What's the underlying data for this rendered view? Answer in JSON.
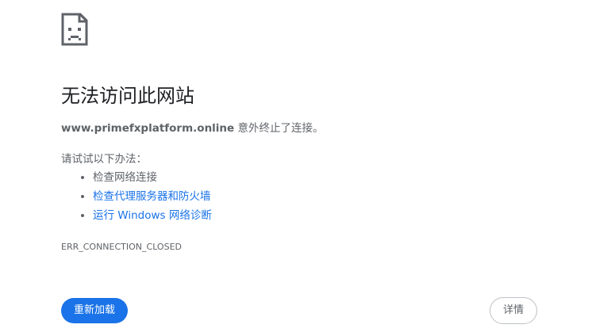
{
  "error": {
    "icon": "sad-page-icon",
    "title": "无法访问此网站",
    "host": "www.primefxplatform.online",
    "summary_suffix": " 意外终止了连接。",
    "suggestions_heading": "请试试以下办法：",
    "suggestions": [
      {
        "label": "检查网络连接",
        "link": false
      },
      {
        "label": "检查代理服务器和防火墙",
        "link": true
      },
      {
        "label": "运行 Windows 网络诊断",
        "link": true
      }
    ],
    "code": "ERR_CONNECTION_CLOSED"
  },
  "buttons": {
    "reload": "重新加载",
    "details": "详情"
  },
  "colors": {
    "accent": "#1a73e8",
    "text_primary": "#202124",
    "text_secondary": "#5f6368",
    "border": "#bdc1c6"
  }
}
